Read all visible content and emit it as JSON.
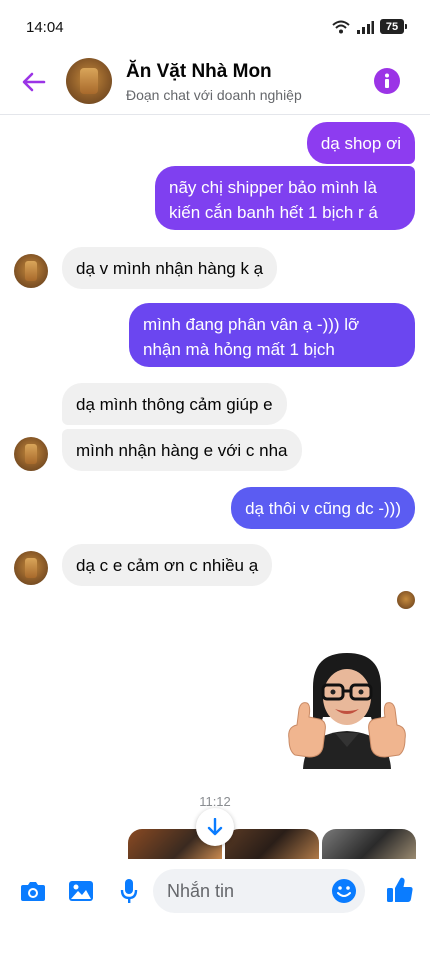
{
  "status_bar": {
    "time": "14:04",
    "battery": "75"
  },
  "header": {
    "title": "Ăn Vặt Nhà Mon",
    "subtitle": "Đoạn chat với doanh nghiệp"
  },
  "messages": [
    {
      "from": "me",
      "text": "dạ shop ơi"
    },
    {
      "from": "me",
      "text": "nãy chị shipper bảo mình là kiến cắn banh hết 1 bịch r á"
    },
    {
      "from": "shop",
      "text": "dạ v mình nhận hàng k ạ"
    },
    {
      "from": "me",
      "text": "mình đang phân vân ạ -))) lỡ nhận mà hỏng mất 1 bịch"
    },
    {
      "from": "shop",
      "text": "dạ mình thông cảm giúp e"
    },
    {
      "from": "shop",
      "text": "mình nhận hàng e với c nha"
    },
    {
      "from": "me",
      "text": "dạ thôi v cũng dc -)))"
    },
    {
      "from": "shop",
      "text": "dạ c e cảm ơn c nhiều ạ"
    }
  ],
  "timestamp": "11:12",
  "composer": {
    "placeholder": "Nhắn tin"
  },
  "colors": {
    "accent": "#9b34e6",
    "bubble_purple": "#8d3cf0",
    "bubble_indigo": "#6b46f0",
    "bubble_blue": "#5b5cf2",
    "incoming_bubble": "#f0f0f0",
    "composer_icons": "#0a7cff"
  },
  "icons": [
    "back-arrow-icon",
    "info-icon",
    "camera-icon",
    "image-icon",
    "microphone-icon",
    "emoji-icon",
    "thumbs-up-icon",
    "arrow-down-icon"
  ]
}
